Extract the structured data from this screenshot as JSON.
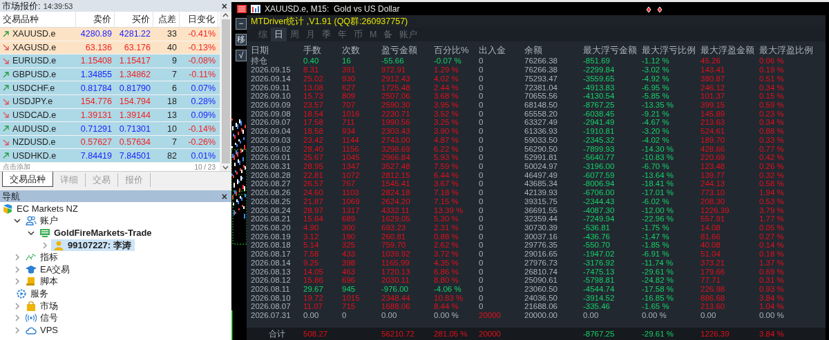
{
  "market_watch": {
    "title": "市场报价:",
    "time": "14:39:53",
    "close": "×",
    "columns": [
      "交易品种",
      "卖价",
      "买价",
      "点差",
      "日变化"
    ],
    "rows": [
      {
        "symbol": "XAUUSD.e",
        "up": true,
        "bid": "4280.89",
        "bid_up": true,
        "ask": "4281.22",
        "ask_up": true,
        "spread": "33",
        "change": "-0.41%",
        "change_up": false,
        "highlighted": true
      },
      {
        "symbol": "XAGUSD.e",
        "up": false,
        "bid": "63.136",
        "bid_up": false,
        "ask": "63.176",
        "ask_up": false,
        "spread": "40",
        "change": "-0.13%",
        "change_up": false,
        "highlighted": true
      },
      {
        "symbol": "EURUSD.e",
        "up": false,
        "bid": "1.15408",
        "bid_up": false,
        "ask": "1.15417",
        "ask_up": false,
        "spread": "9",
        "change": "-0.08%",
        "change_up": false,
        "highlighted": false
      },
      {
        "symbol": "GBPUSD.e",
        "up": true,
        "bid": "1.34855",
        "bid_up": true,
        "ask": "1.34862",
        "ask_up": false,
        "spread": "7",
        "change": "-0.11%",
        "change_up": false,
        "highlighted": false
      },
      {
        "symbol": "USDCHF.e",
        "up": true,
        "bid": "0.81784",
        "bid_up": true,
        "ask": "0.81790",
        "ask_up": true,
        "spread": "6",
        "change": "0.07%",
        "change_up": true,
        "highlighted": false
      },
      {
        "symbol": "USDJPY.e",
        "up": false,
        "bid": "154.776",
        "bid_up": false,
        "ask": "154.794",
        "ask_up": false,
        "spread": "18",
        "change": "0.28%",
        "change_up": true,
        "highlighted": false
      },
      {
        "symbol": "USDCAD.e",
        "up": false,
        "bid": "1.39131",
        "bid_up": false,
        "ask": "1.39144",
        "ask_up": false,
        "spread": "13",
        "change": "0.09%",
        "change_up": true,
        "highlighted": false
      },
      {
        "symbol": "AUDUSD.e",
        "up": true,
        "bid": "0.71291",
        "bid_up": true,
        "ask": "0.71301",
        "ask_up": true,
        "spread": "10",
        "change": "-0.14%",
        "change_up": false,
        "highlighted": false
      },
      {
        "symbol": "NZDUSD.e",
        "up": false,
        "bid": "0.57627",
        "bid_up": false,
        "ask": "0.57634",
        "ask_up": false,
        "spread": "7",
        "change": "-0.26%",
        "change_up": false,
        "highlighted": false
      },
      {
        "symbol": "USDHKD.e",
        "up": true,
        "bid": "7.84419",
        "bid_up": true,
        "ask": "7.84501",
        "ask_up": true,
        "spread": "82",
        "change": "0.01%",
        "change_up": true,
        "highlighted": false
      }
    ],
    "add_label": "点击添加",
    "count": "10 / 23",
    "tabs": [
      {
        "label": "交易品种",
        "selected": true
      },
      {
        "label": "详细",
        "selected": false
      },
      {
        "label": "交易",
        "selected": false
      },
      {
        "label": "报价",
        "selected": false
      }
    ]
  },
  "navigator": {
    "title": "导航",
    "close": "×",
    "tree": [
      {
        "label": "EC Markets NZ",
        "kind": "broker",
        "selected": false,
        "children": [
          {
            "label": "账户",
            "kind": "accounts",
            "expanded": true,
            "selected": false,
            "children": [
              {
                "label": "GoldFireMarkets-Trade",
                "kind": "server",
                "expanded": true,
                "selected": false,
                "children": [
                  {
                    "label": "99107227: 李涛",
                    "kind": "account",
                    "expanded": false,
                    "selected": true
                  }
                ]
              }
            ]
          },
          {
            "label": "指标",
            "kind": "indicators",
            "expanded": false,
            "selected": false
          },
          {
            "label": "EA交易",
            "kind": "experts",
            "expanded": false,
            "selected": false
          },
          {
            "label": "脚本",
            "kind": "scripts",
            "expanded": false,
            "selected": false
          },
          {
            "label": "服务",
            "kind": "services",
            "selected": false
          },
          {
            "label": "市场",
            "kind": "market",
            "expanded": false,
            "selected": false
          },
          {
            "label": "信号",
            "kind": "signals",
            "expanded": false,
            "selected": false
          },
          {
            "label": "VPS",
            "kind": "vps",
            "expanded": false,
            "selected": false
          }
        ]
      }
    ]
  },
  "chart_window": {
    "title": "XAUUSD.e, M15:  Gold vs US Dollar",
    "side_buttons": [
      "−",
      "移",
      "√"
    ]
  },
  "stats_panel": {
    "title": "MTDriver统计 ,V1.91 (QQ群:260937757)",
    "tabs": [
      {
        "label": "综",
        "selected": false
      },
      {
        "label": "日",
        "selected": true
      },
      {
        "label": "周",
        "selected": false
      },
      {
        "label": "月",
        "selected": false
      },
      {
        "label": "季",
        "selected": false
      },
      {
        "label": "年",
        "selected": false
      },
      {
        "label": "币",
        "selected": false
      },
      {
        "label": "M",
        "selected": false
      },
      {
        "label": "备",
        "selected": false
      },
      {
        "label": "账户",
        "selected": false
      }
    ],
    "columns": [
      "日期",
      "手数",
      "次数",
      "盈亏金额",
      "百分比%",
      "出入金",
      "余额",
      "最大浮亏金额",
      "最大浮亏比例",
      "最大浮盈金额",
      "最大浮盈比例"
    ],
    "rows": [
      {
        "kind": "position",
        "loss": true,
        "cells": [
          "持仓",
          "0.40",
          "16",
          "-55.66",
          "-0.07 %",
          "0",
          "76266.38",
          "-851.69",
          "-1.12 %",
          "45.26",
          "0.06 %"
        ]
      },
      {
        "kind": "day",
        "loss": false,
        "cells": [
          "2026.09.15",
          "8.31",
          "391",
          "972.91",
          "1.29 %",
          "0",
          "76266.38",
          "-2299.84",
          "-3.02 %",
          "143.41",
          "0.19 %"
        ]
      },
      {
        "kind": "day",
        "loss": false,
        "cells": [
          "2026.09.14",
          "25.02",
          "930",
          "2912.43",
          "4.02 %",
          "0",
          "75293.47",
          "-3559.65",
          "-4.92 %",
          "380.87",
          "0.51 %"
        ]
      },
      {
        "kind": "day",
        "loss": false,
        "cells": [
          "2026.09.11",
          "13.08",
          "627",
          "1725.48",
          "2.44 %",
          "0",
          "72381.04",
          "-4913.83",
          "-6.95 %",
          "246.12",
          "0.34 %"
        ]
      },
      {
        "kind": "day",
        "loss": false,
        "cells": [
          "2026.09.10",
          "15.73",
          "809",
          "2507.06",
          "3.68 %",
          "0",
          "70655.56",
          "-4130.54",
          "-5.85 %",
          "101.37",
          "0.15 %"
        ]
      },
      {
        "kind": "day",
        "loss": false,
        "cells": [
          "2026.09.09",
          "23.57",
          "707",
          "2590.30",
          "3.95 %",
          "0",
          "68148.50",
          "-8767.25",
          "-13.35 %",
          "399.15",
          "0.59 %"
        ]
      },
      {
        "kind": "day",
        "loss": false,
        "cells": [
          "2026.09.08",
          "18.54",
          "1016",
          "2230.71",
          "3.52 %",
          "0",
          "65558.20",
          "-6038.45",
          "-9.21 %",
          "145.89",
          "0.23 %"
        ]
      },
      {
        "kind": "day",
        "loss": false,
        "cells": [
          "2026.09.07",
          "17.58",
          "711",
          "1990.56",
          "3.25 %",
          "0",
          "63327.49",
          "-2941.49",
          "-4.67 %",
          "213.63",
          "0.34 %"
        ]
      },
      {
        "kind": "day",
        "loss": false,
        "cells": [
          "2026.09.04",
          "18.58",
          "934",
          "2303.43",
          "3.90 %",
          "0",
          "61336.93",
          "-1910.81",
          "-3.20 %",
          "524.61",
          "0.88 %"
        ]
      },
      {
        "kind": "day",
        "loss": false,
        "cells": [
          "2026.09.03",
          "23.42",
          "1144",
          "2743.00",
          "4.87 %",
          "0",
          "59033.50",
          "-2345.32",
          "-4.02 %",
          "189.70",
          "0.33 %"
        ]
      },
      {
        "kind": "day",
        "loss": false,
        "cells": [
          "2026.09.02",
          "28.40",
          "1156",
          "3298.69",
          "6.22 %",
          "0",
          "56290.50",
          "-7899.93",
          "-14.30 %",
          "428.66",
          "0.77 %"
        ]
      },
      {
        "kind": "day",
        "loss": false,
        "cells": [
          "2026.09.01",
          "25.67",
          "1045",
          "2966.84",
          "5.93 %",
          "0",
          "52991.81",
          "-5640.77",
          "-10.83 %",
          "220.69",
          "0.42 %"
        ]
      },
      {
        "kind": "day",
        "loss": false,
        "cells": [
          "2026.08.31",
          "28.95",
          "1347",
          "3527.48",
          "7.59 %",
          "0",
          "50024.97",
          "-3196.00",
          "-6.70 %",
          "123.48",
          "0.26 %"
        ]
      },
      {
        "kind": "day",
        "loss": false,
        "cells": [
          "2026.08.28",
          "22.81",
          "1072",
          "2812.15",
          "6.44 %",
          "0",
          "46497.49",
          "-6077.59",
          "-13.64 %",
          "139.77",
          "0.32 %"
        ]
      },
      {
        "kind": "day",
        "loss": false,
        "cells": [
          "2026.08.27",
          "26.57",
          "767",
          "1545.41",
          "3.67 %",
          "0",
          "43685.34",
          "-8006.94",
          "-18.41 %",
          "244.13",
          "0.58 %"
        ]
      },
      {
        "kind": "day",
        "loss": false,
        "cells": [
          "2026.08.26",
          "24.60",
          "1103",
          "2824.18",
          "7.18 %",
          "0",
          "42139.93",
          "-6706.00",
          "-17.01 %",
          "773.10",
          "1.94 %"
        ]
      },
      {
        "kind": "day",
        "loss": false,
        "cells": [
          "2026.08.25",
          "21.87",
          "1069",
          "2624.20",
          "7.15 %",
          "0",
          "39315.75",
          "-2344.43",
          "-6.02 %",
          "208.30",
          "0.53 %"
        ]
      },
      {
        "kind": "day",
        "loss": false,
        "cells": [
          "2026.08.24",
          "28.97",
          "1317",
          "4332.11",
          "13.39 %",
          "0",
          "36691.55",
          "-4087.30",
          "-12.00 %",
          "1226.39",
          "3.79 %"
        ]
      },
      {
        "kind": "day",
        "loss": false,
        "cells": [
          "2026.08.21",
          "15.84",
          "689",
          "1629.05",
          "5.30 %",
          "0",
          "32359.44",
          "-7249.94",
          "-22.96 %",
          "557.91",
          "1.77 %"
        ]
      },
      {
        "kind": "day",
        "loss": false,
        "cells": [
          "2026.08.20",
          "4.90",
          "300",
          "693.23",
          "2.31 %",
          "0",
          "30730.39",
          "-536.81",
          "-1.75 %",
          "14.08",
          "0.05 %"
        ]
      },
      {
        "kind": "day",
        "loss": false,
        "cells": [
          "2026.08.19",
          "3.12",
          "190",
          "260.81",
          "0.88 %",
          "0",
          "30037.16",
          "-436.76",
          "-1.47 %",
          "81.66",
          "0.27 %"
        ]
      },
      {
        "kind": "day",
        "loss": false,
        "cells": [
          "2026.08.18",
          "5.14",
          "325",
          "759.70",
          "2.62 %",
          "0",
          "29776.35",
          "-550.70",
          "-1.85 %",
          "40.08",
          "0.14 %"
        ]
      },
      {
        "kind": "day",
        "loss": false,
        "cells": [
          "2026.08.17",
          "7.58",
          "433",
          "1039.92",
          "3.72 %",
          "0",
          "29016.65",
          "-1947.02",
          "-6.91 %",
          "51.04",
          "0.18 %"
        ]
      },
      {
        "kind": "day",
        "loss": false,
        "cells": [
          "2026.08.14",
          "9.25",
          "398",
          "1165.99",
          "4.35 %",
          "0",
          "27976.73",
          "-3176.92",
          "-11.74 %",
          "373.21",
          "1.37 %"
        ]
      },
      {
        "kind": "day",
        "loss": false,
        "cells": [
          "2026.08.13",
          "14.05",
          "463",
          "1720.13",
          "6.86 %",
          "0",
          "26810.74",
          "-7475.13",
          "-29.61 %",
          "179.66",
          "0.69 %"
        ]
      },
      {
        "kind": "day",
        "loss": false,
        "cells": [
          "2026.08.12",
          "15.86",
          "696",
          "2030.11",
          "8.80 %",
          "0",
          "25090.61",
          "-5798.81",
          "-24.82 %",
          "77.71",
          "0.31 %"
        ]
      },
      {
        "kind": "day",
        "loss": true,
        "cells": [
          "2026.08.11",
          "29.67",
          "945",
          "-976.00",
          "-4.06 %",
          "0",
          "23060.50",
          "-4544.74",
          "-17.58 %",
          "226.98",
          "0.93 %"
        ]
      },
      {
        "kind": "day",
        "loss": false,
        "cells": [
          "2026.08.10",
          "19.72",
          "1015",
          "2348.44",
          "10.83 %",
          "0",
          "24036.50",
          "-3914.52",
          "-16.85 %",
          "886.68",
          "3.84 %"
        ]
      },
      {
        "kind": "day",
        "loss": false,
        "cells": [
          "2026.08.07",
          "11.07",
          "715",
          "1688.06",
          "8.44 %",
          "0",
          "21688.06",
          "-335.46",
          "-1.65 %",
          "213.60",
          "1.04 %"
        ]
      },
      {
        "kind": "opening",
        "cells": [
          "2026.07.31",
          "0.00",
          "0",
          "0.00",
          "0.00 %",
          "20000",
          "20000.00",
          "0.00",
          "0.00 %",
          "0.00",
          "0.00 %"
        ]
      },
      {
        "kind": "total",
        "loss": false,
        "cells": [
          "合计",
          "508.27",
          null,
          "56210.72",
          "281.05 %",
          "20000",
          null,
          "-8767.25",
          "-29.61 %",
          "1226.39",
          "3.84 %"
        ]
      }
    ]
  }
}
